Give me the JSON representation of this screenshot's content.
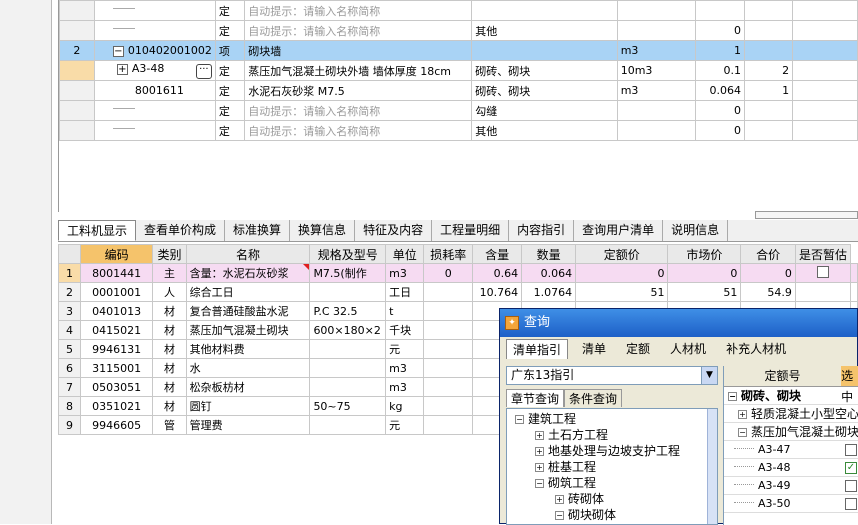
{
  "upper_rows": [
    {
      "no": "",
      "code": "",
      "type": "定",
      "name": "自动提示：请输入名称简称",
      "name_hint": true,
      "feature": "",
      "unit": "",
      "qty": "",
      "price": "",
      "extra": ""
    },
    {
      "no": "",
      "code": "",
      "type": "定",
      "name": "自动提示：请输入名称简称",
      "name_hint": true,
      "feature": "其他",
      "unit": "",
      "qty": "0",
      "price": "",
      "extra": ""
    },
    {
      "no": "2",
      "code": "010402001002",
      "type": "项",
      "name": "砌块墙",
      "name_hint": false,
      "feature": "",
      "unit": "m3",
      "qty": "1",
      "price": "",
      "extra": ""
    },
    {
      "no": "",
      "code": "A3-48",
      "type": "定",
      "name": "蒸压加气混凝土砌块外墙 墙体厚度 18cm",
      "name_hint": false,
      "feature": "砌砖、砌块",
      "unit": "10m3",
      "qty": "0.1",
      "price": "2",
      "extra": ""
    },
    {
      "no": "",
      "code": "8001611",
      "type": "定",
      "name": "水泥石灰砂浆 M7.5",
      "name_hint": false,
      "feature": "砌砖、砌块",
      "unit": "m3",
      "qty": "0.064",
      "price": "1",
      "extra": ""
    },
    {
      "no": "",
      "code": "",
      "type": "定",
      "name": "自动提示：请输入名称简称",
      "name_hint": true,
      "feature": "勾缝",
      "unit": "",
      "qty": "0",
      "price": "",
      "extra": ""
    },
    {
      "no": "",
      "code": "",
      "type": "定",
      "name": "自动提示：请输入名称简称",
      "name_hint": true,
      "feature": "其他",
      "unit": "",
      "qty": "0",
      "price": "",
      "extra": ""
    }
  ],
  "tabs": [
    "工料机显示",
    "查看单价构成",
    "标准换算",
    "换算信息",
    "特征及内容",
    "工程量明细",
    "内容指引",
    "查询用户清单",
    "说明信息"
  ],
  "lower_headers": [
    "编码",
    "类别",
    "名称",
    "规格及型号",
    "单位",
    "损耗率",
    "含量",
    "数量",
    "定额价",
    "市场价",
    "合价",
    "是否暂估"
  ],
  "lower_rows": [
    {
      "no": "1",
      "code": "8001441",
      "cat": "主",
      "name": "含量：水泥石灰砂浆",
      "spec": "M7.5(制作",
      "unit": "m3",
      "loss": "0",
      "content": "0.64",
      "qty": "0.064",
      "quota": "0",
      "market": "0",
      "total": "0"
    },
    {
      "no": "2",
      "code": "0001001",
      "cat": "人",
      "name": "综合工日",
      "spec": "",
      "unit": "工日",
      "loss": "",
      "content": "10.764",
      "qty": "1.0764",
      "quota": "51",
      "market": "51",
      "total": "54.9"
    },
    {
      "no": "3",
      "code": "0401013",
      "cat": "材",
      "name": "复合普通硅酸盐水泥",
      "spec": "P.C 32.5",
      "unit": "t",
      "loss": "",
      "content": "",
      "qty": "",
      "quota": "",
      "market": "",
      "total": ""
    },
    {
      "no": "4",
      "code": "0415021",
      "cat": "材",
      "name": "蒸压加气混凝土砌块",
      "spec": "600×180×2",
      "unit": "千块",
      "loss": "",
      "content": "",
      "qty": "",
      "quota": "",
      "market": "",
      "total": ""
    },
    {
      "no": "5",
      "code": "9946131",
      "cat": "材",
      "name": "其他材料费",
      "spec": "",
      "unit": "元",
      "loss": "",
      "content": "",
      "qty": "",
      "quota": "",
      "market": "",
      "total": ""
    },
    {
      "no": "6",
      "code": "3115001",
      "cat": "材",
      "name": "水",
      "spec": "",
      "unit": "m3",
      "loss": "",
      "content": "",
      "qty": "",
      "quota": "",
      "market": "",
      "total": ""
    },
    {
      "no": "7",
      "code": "0503051",
      "cat": "材",
      "name": "松杂板枋材",
      "spec": "",
      "unit": "m3",
      "loss": "",
      "content": "",
      "qty": "",
      "quota": "",
      "market": "",
      "total": ""
    },
    {
      "no": "8",
      "code": "0351021",
      "cat": "材",
      "name": "圆钉",
      "spec": "50~75",
      "unit": "kg",
      "loss": "",
      "content": "",
      "qty": "",
      "quota": "",
      "market": "",
      "total": ""
    },
    {
      "no": "9",
      "code": "9946605",
      "cat": "管",
      "name": "管理费",
      "spec": "",
      "unit": "元",
      "loss": "",
      "content": "",
      "qty": "",
      "quota": "",
      "market": "",
      "total": ""
    }
  ],
  "dialog": {
    "title": "查询",
    "tabs": [
      "清单指引",
      "清单",
      "定额",
      "人材机",
      "补充人材机"
    ],
    "combo_value": "广东13指引",
    "subtabs": [
      "章节查询",
      "条件查询"
    ],
    "tree": [
      {
        "label": "建筑工程",
        "sign": "−",
        "level": 0
      },
      {
        "label": "土石方工程",
        "sign": "+",
        "level": 1
      },
      {
        "label": "地基处理与边坡支护工程",
        "sign": "+",
        "level": 1
      },
      {
        "label": "桩基工程",
        "sign": "+",
        "level": 1
      },
      {
        "label": "砌筑工程",
        "sign": "−",
        "level": 1
      },
      {
        "label": "砖砌体",
        "sign": "+",
        "level": 2
      },
      {
        "label": "砌块砌体",
        "sign": "−",
        "level": 2
      }
    ],
    "right_header": "定额号",
    "right_header_sel": "选中",
    "right_groups": [
      {
        "label": "砌砖、砌块",
        "sign": "−"
      },
      {
        "label": "轻质混凝土小型空心",
        "sign": "+"
      },
      {
        "label": "蒸压加气混凝土砌块",
        "sign": "−"
      }
    ],
    "right_items": [
      {
        "code": "A3-47",
        "checked": false
      },
      {
        "code": "A3-48",
        "checked": true
      },
      {
        "code": "A3-49",
        "checked": false
      },
      {
        "code": "A3-50",
        "checked": false
      }
    ]
  }
}
